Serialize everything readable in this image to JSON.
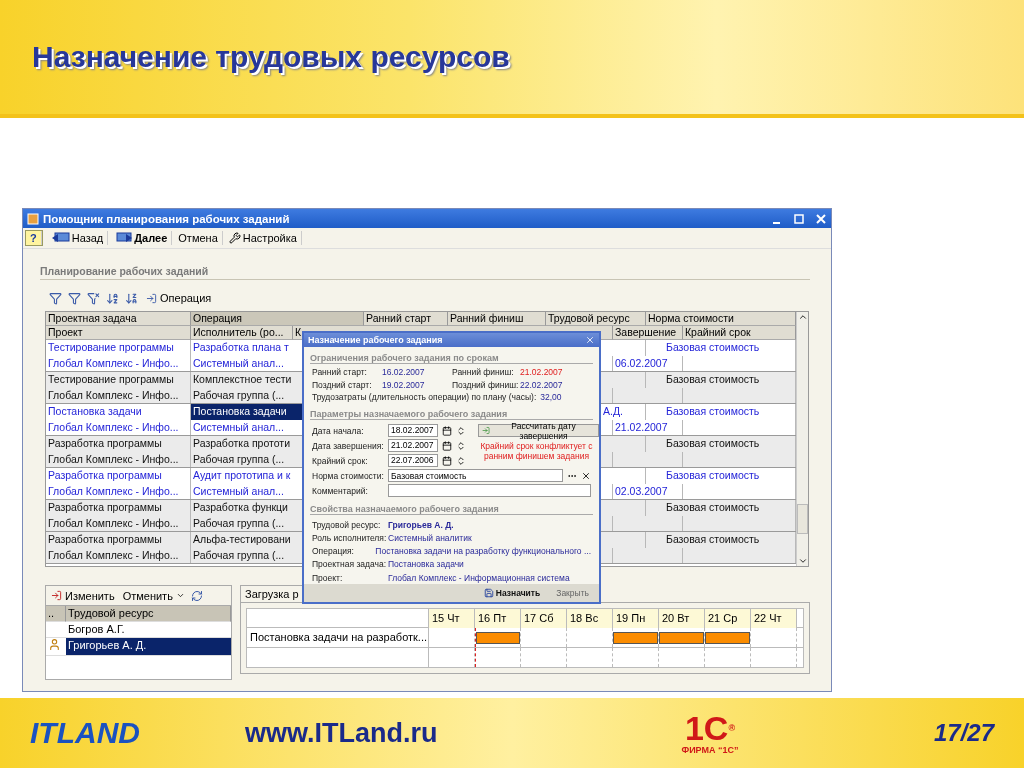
{
  "slide": {
    "title": "Назначение трудовых ресурсов",
    "logo_left": "ITLAND",
    "url": "www.ITLand.ru",
    "logo_right": "1С",
    "logo_right_mark": "®",
    "logo_right_caption": "ФИРМА “1С”",
    "page": "17/27"
  },
  "window": {
    "title": "Помощник планирования рабочих заданий",
    "toolbar": [
      {
        "label": "?",
        "kind": "help"
      },
      {
        "label": "Назад",
        "kind": "back"
      },
      {
        "label": "Далее",
        "kind": "next"
      },
      {
        "label": "Отмена",
        "kind": "plain"
      },
      {
        "label": "Настройка",
        "kind": "settings"
      }
    ],
    "section_title": "Планирование рабочих заданий",
    "table_action": "Операция"
  },
  "table": {
    "header_top": [
      "Проектная задача",
      "Операция",
      "Ранний старт",
      "Ранний финиш",
      "Трудовой ресурс",
      "Норма стоимости"
    ],
    "header_bottom": [
      "Проект",
      "Исполнитель (ро...",
      "К",
      "Завершение",
      "Крайний срок"
    ],
    "rows": [
      {
        "task": "Тестирование программы",
        "operation": "Разработка плана т",
        "project": "Глобал Комплекс - Инфо...",
        "performer": "Системный анал...",
        "norm": "Базовая стоимость",
        "end": "06.02.2007",
        "kind": "marked",
        "selected": false
      },
      {
        "task": "Тестирование программы",
        "operation": "Комплекстное тести",
        "project": "Глобал Комплекс - Инфо...",
        "performer": "Рабочая группа (...",
        "norm": "Базовая стоимость",
        "kind": "plain",
        "selected": false
      },
      {
        "task": "Постановка задачи",
        "operation": "Постановка задачи",
        "project": "Глобал Комплекс - Инфо...",
        "performer": "Системный анал...",
        "resource": "А.Д.",
        "norm": "Базовая стоимость",
        "end": "21.02.2007",
        "kind": "marked",
        "selected": true
      },
      {
        "task": "Разработка программы",
        "operation": "Разработка прототи",
        "project": "Глобал Комплекс - Инфо...",
        "performer": "Рабочая группа (...",
        "norm": "Базовая стоимость",
        "kind": "plain",
        "selected": false
      },
      {
        "task": "Разработка программы",
        "operation": "Аудит прототипа и к",
        "project": "Глобал Комплекс - Инфо...",
        "performer": "Системный анал...",
        "norm": "Базовая стоимость",
        "end": "02.03.2007",
        "kind": "marked",
        "selected": false
      },
      {
        "task": "Разработка программы",
        "operation": "Разработка функци",
        "project": "Глобал Комплекс - Инфо...",
        "performer": "Рабочая группа (...",
        "norm": "Базовая стоимость",
        "kind": "plain",
        "selected": false
      },
      {
        "task": "Разработка программы",
        "operation": "Альфа-тестировани",
        "project": "Глобал Комплекс - Инфо...",
        "performer": "Рабочая группа (...",
        "norm": "Базовая стоимость",
        "kind": "plain",
        "selected": false
      }
    ]
  },
  "dialog": {
    "title": "Назначение рабочего задания",
    "section1": "Ограничения рабочего задания по срокам",
    "dates": [
      {
        "label": "Ранний старт:",
        "value": "16.02.2007",
        "warning": false
      },
      {
        "label": "Ранний финиш:",
        "value": "21.02.2007",
        "warning": true
      },
      {
        "label": "Поздний старт:",
        "value": "19.02.2007",
        "warning": false
      },
      {
        "label": "Поздний финиш:",
        "value": "22.02.2007",
        "warning": false
      }
    ],
    "effort": {
      "label": "Трудозатраты (длительность операции) по плану (часы):",
      "value": "32,00"
    },
    "section2": "Параметры назначаемого рабочего задания",
    "date_fields": [
      {
        "label": "Дата начала:",
        "value": "18.02.2007"
      },
      {
        "label": "Дата завершения:",
        "value": "21.02.2007"
      },
      {
        "label": "Крайний срок:",
        "value": "22.07.2006"
      }
    ],
    "calc_button": "Рассчитать дату завершения",
    "warning": "Крайний срок конфликтует с ранним финишем задания",
    "norm": {
      "label": "Норма стоимости:",
      "value": "Базовая стоимость"
    },
    "comment_label": "Комментарий:",
    "section3": "Свойства назначаемого рабочего задания",
    "props": [
      {
        "label": "Трудовой ресурс:",
        "value": "Григорьев А. Д.",
        "bold": true
      },
      {
        "label": "Роль исполнителя:",
        "value": "Системный аналитик",
        "bold": false
      },
      {
        "label": "Операция:",
        "value": "Постановка задачи на разработку функционального ...",
        "bold": false
      },
      {
        "label": "Проектная задача:",
        "value": "Постановка задачи",
        "bold": false
      },
      {
        "label": "Проект:",
        "value": "Глобал Комплекс - Информационная система",
        "bold": false
      }
    ],
    "buttons": [
      {
        "label": "Назначить",
        "kind": "primary"
      },
      {
        "label": "Закрыть",
        "kind": "secondary"
      }
    ]
  },
  "resources": {
    "toolbar": [
      "Изменить",
      "Отменить"
    ],
    "columns": [
      "..",
      "Трудовой ресурс"
    ],
    "rows": [
      {
        "name": "Богров А.Г.",
        "selected": false,
        "assigned": false
      },
      {
        "name": "Григорьев А. Д.",
        "selected": true,
        "assigned": true
      }
    ]
  },
  "load": {
    "tab": "Загрузка р",
    "days": [
      {
        "label": "15 Чт",
        "today": false
      },
      {
        "label": "16 Пт",
        "today": true
      },
      {
        "label": "17 Сб",
        "today": false
      },
      {
        "label": "18 Вс",
        "today": false
      },
      {
        "label": "19 Пн",
        "today": false
      },
      {
        "label": "20 Вт",
        "today": false
      },
      {
        "label": "21 Ср",
        "today": false
      },
      {
        "label": "22 Чт",
        "today": false
      }
    ],
    "rows": [
      {
        "label": "Постановка задачи на разработк...",
        "busy": [
          false,
          true,
          false,
          false,
          true,
          true,
          true,
          false
        ]
      },
      {
        "busy": [
          false,
          false,
          false,
          false,
          false,
          false,
          false,
          false
        ]
      }
    ]
  }
}
